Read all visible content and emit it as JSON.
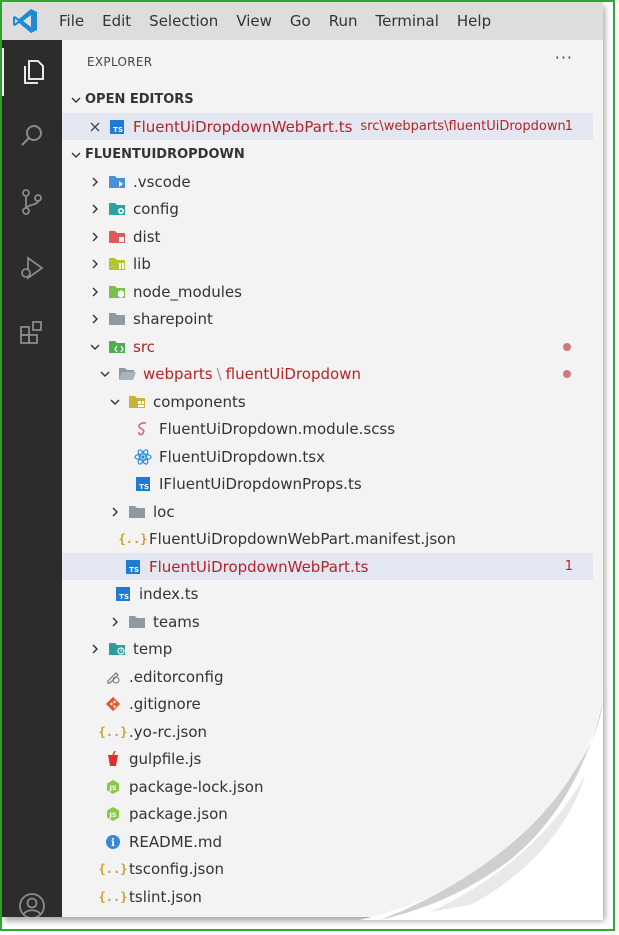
{
  "menu": {
    "items": [
      "File",
      "Edit",
      "Selection",
      "View",
      "Go",
      "Run",
      "Terminal",
      "Help"
    ]
  },
  "explorer": {
    "title": "EXPLORER",
    "more": "···"
  },
  "open_editors": {
    "header": "OPEN EDITORS",
    "file": {
      "name": "FluentUiDropdownWebPart.ts",
      "path": "src\\webparts\\fluentUiDropdown",
      "problems": "1"
    }
  },
  "project": {
    "header": "FLUENTUIDROPDOWN",
    "folders": {
      "vscode": ".vscode",
      "config": "config",
      "dist": "dist",
      "lib": "lib",
      "node_modules": "node_modules",
      "sharepoint": "sharepoint",
      "src": "src",
      "webparts": "webparts",
      "fluentUiDropdown": "fluentUiDropdown",
      "separator": "\\",
      "components": "components",
      "loc": "loc",
      "teams": "teams",
      "temp": "temp"
    },
    "files": {
      "module_scss": "FluentUiDropdown.module.scss",
      "tsx": "FluentUiDropdown.tsx",
      "props": "IFluentUiDropdownProps.ts",
      "manifest": "FluentUiDropdownWebPart.manifest.json",
      "webpart": "FluentUiDropdownWebPart.ts",
      "webpart_problems": "1",
      "index": "index.ts",
      "editorconfig": ".editorconfig",
      "gitignore": ".gitignore",
      "yorc": ".yo-rc.json",
      "gulpfile": "gulpfile.js",
      "package_lock": "package-lock.json",
      "package": "package.json",
      "readme": "README.md",
      "tsconfig": "tsconfig.json",
      "tslint": "tslint.json"
    },
    "icon_labels": {
      "ts": "TS",
      "json": "{..}",
      "info": "i",
      "js": "JS"
    }
  },
  "colors": {
    "error_text": "#b52424",
    "activity_bar": "#2c2c2c",
    "sidebar": "#f3f3f3",
    "menubar": "#dddddd",
    "frame_border": "#2eaa2e"
  }
}
